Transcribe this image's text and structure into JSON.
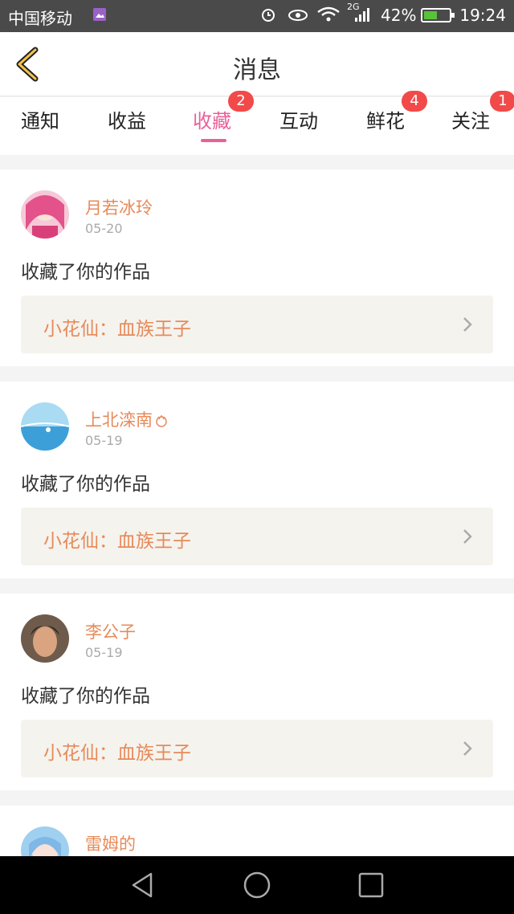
{
  "status_bar": {
    "carrier": "中国移动",
    "network": "2G",
    "battery_percent": "42%",
    "time": "19:24",
    "icons": [
      "alarm-icon",
      "eye-icon",
      "wifi-icon",
      "signal-icon",
      "battery-icon"
    ]
  },
  "header": {
    "title": "消息",
    "back_icon": "chevron-left-icon"
  },
  "tabs": [
    {
      "label": "通知",
      "badge": "",
      "active": false
    },
    {
      "label": "收益",
      "badge": "",
      "active": false
    },
    {
      "label": "收藏",
      "badge": "2",
      "active": true
    },
    {
      "label": "互动",
      "badge": "",
      "active": false
    },
    {
      "label": "鲜花",
      "badge": "4",
      "active": false
    },
    {
      "label": "关注",
      "badge": "1",
      "active": false
    }
  ],
  "messages": [
    {
      "user": "月若冰玲",
      "date": "05-20",
      "action": "收藏了你的作品",
      "work": "小花仙：血族王子"
    },
    {
      "user": "上北滦南",
      "date": "05-19",
      "action": "收藏了你的作品",
      "work": "小花仙：血族王子"
    },
    {
      "user": "李公子",
      "date": "05-19",
      "action": "收藏了你的作品",
      "work": "小花仙：血族王子"
    },
    {
      "user": "雷姆的"
    }
  ],
  "colors": {
    "accent_pink": "#e8619a",
    "name_orange": "#e78a5a",
    "badge_red": "#f24949"
  }
}
